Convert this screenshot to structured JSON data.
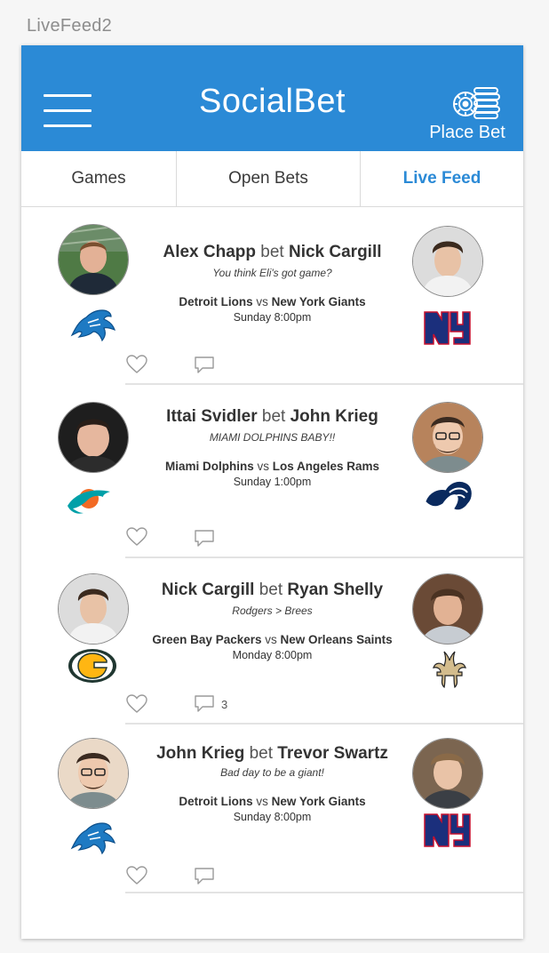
{
  "artboard_label": "LiveFeed2",
  "header": {
    "title": "SocialBet",
    "place_bet_label": "Place Bet",
    "color": "#2b8ad6",
    "menu_icon": "hamburger-icon",
    "place_bet_icon": "casino-chips-icon"
  },
  "tabs": [
    {
      "label": "Games",
      "active": false
    },
    {
      "label": "Open Bets",
      "active": false
    },
    {
      "label": "Live Feed",
      "active": true
    }
  ],
  "feed": [
    {
      "bettor": "Alex Chapp",
      "bet_word": "bet",
      "opponent": "Nick Cargill",
      "quote": "You think Eli's got game?",
      "team_a": "Detroit Lions",
      "vs": "vs",
      "team_b": "New York Giants",
      "time": "Sunday 8:00pm",
      "comments": "",
      "logo_a": "detroit-lions-logo",
      "logo_b": "new-york-giants-logo"
    },
    {
      "bettor": "Ittai Svidler",
      "bet_word": "bet",
      "opponent": "John Krieg",
      "quote": "MIAMI DOLPHINS BABY!!",
      "team_a": "Miami Dolphins",
      "vs": "vs",
      "team_b": "Los Angeles Rams",
      "time": "Sunday 1:00pm",
      "comments": "",
      "logo_a": "miami-dolphins-logo",
      "logo_b": "los-angeles-rams-logo"
    },
    {
      "bettor": "Nick Cargill",
      "bet_word": "bet",
      "opponent": "Ryan Shelly",
      "quote": "Rodgers > Brees",
      "team_a": "Green Bay Packers",
      "vs": "vs",
      "team_b": "New Orleans Saints",
      "time": "Monday 8:00pm",
      "comments": "3",
      "logo_a": "green-bay-packers-logo",
      "logo_b": "new-orleans-saints-logo"
    },
    {
      "bettor": "John Krieg",
      "bet_word": "bet",
      "opponent": "Trevor Swartz",
      "quote": "Bad day to be a giant!",
      "team_a": "Detroit Lions",
      "vs": "vs",
      "team_b": "New York Giants",
      "time": "Sunday 8:00pm",
      "comments": "",
      "logo_a": "detroit-lions-logo",
      "logo_b": "new-york-giants-logo"
    }
  ]
}
